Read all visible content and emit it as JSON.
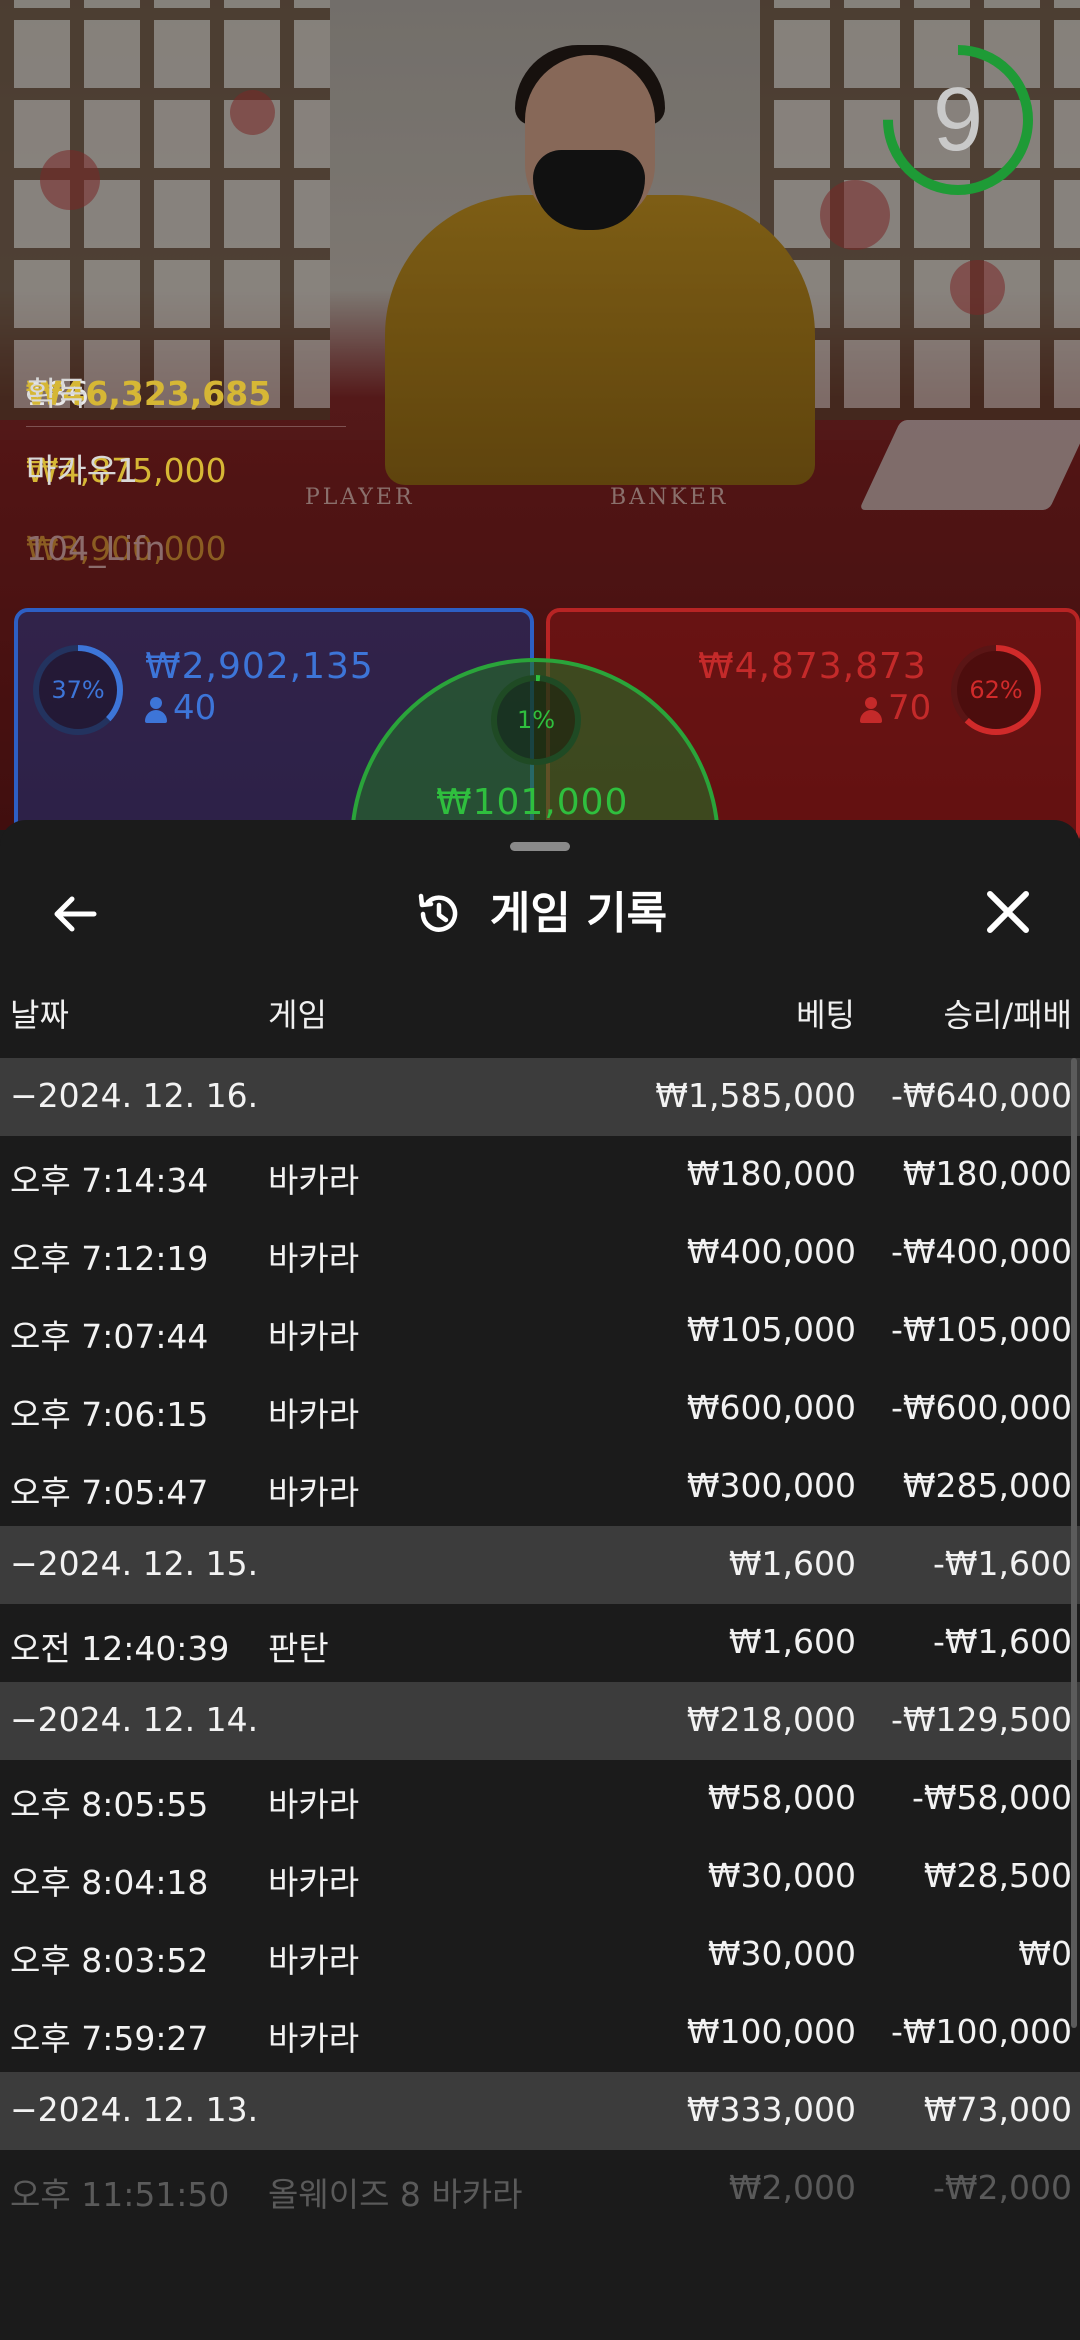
{
  "live": {
    "timer": "9",
    "winners": {
      "count": "186",
      "total": "₩46,323,685",
      "gain_label": "획득",
      "rows": [
        {
          "amount": "₩4,875,000",
          "name": "마카우1"
        },
        {
          "amount": "₩3,900,000",
          "name": "104_Lifn"
        }
      ]
    },
    "table_labels": {
      "player": "PLAYER",
      "banker": "BANKER"
    },
    "player": {
      "percent": "37%",
      "amount": "₩2,902,135",
      "players": "40",
      "color": "#3d75d8"
    },
    "banker": {
      "percent": "62%",
      "amount": "₩4,873,873",
      "players": "70",
      "color": "#c42a2a"
    },
    "tie": {
      "percent": "1%",
      "amount": "₩101,000",
      "color": "#2fbf3e"
    }
  },
  "history": {
    "title": "게임 기록",
    "icons": {
      "back": "arrow-left-icon",
      "history": "history-icon",
      "close": "close-icon"
    },
    "columns": {
      "date": "날짜",
      "game": "게임",
      "bet": "베팅",
      "result": "승리/패배"
    },
    "rows": [
      {
        "type": "group",
        "date": "−2024. 12. 16.",
        "game": "",
        "bet": "₩1,585,000",
        "result": "-₩640,000"
      },
      {
        "type": "item",
        "date": "오후 7:14:34",
        "game": "바카라",
        "bet": "₩180,000",
        "result": "₩180,000"
      },
      {
        "type": "item",
        "date": "오후 7:12:19",
        "game": "바카라",
        "bet": "₩400,000",
        "result": "-₩400,000"
      },
      {
        "type": "item",
        "date": "오후 7:07:44",
        "game": "바카라",
        "bet": "₩105,000",
        "result": "-₩105,000"
      },
      {
        "type": "item",
        "date": "오후 7:06:15",
        "game": "바카라",
        "bet": "₩600,000",
        "result": "-₩600,000"
      },
      {
        "type": "item",
        "date": "오후 7:05:47",
        "game": "바카라",
        "bet": "₩300,000",
        "result": "₩285,000"
      },
      {
        "type": "group",
        "date": "−2024. 12. 15.",
        "game": "",
        "bet": "₩1,600",
        "result": "-₩1,600"
      },
      {
        "type": "item",
        "date": "오전 12:40:39",
        "game": "판탄",
        "bet": "₩1,600",
        "result": "-₩1,600"
      },
      {
        "type": "group",
        "date": "−2024. 12. 14.",
        "game": "",
        "bet": "₩218,000",
        "result": "-₩129,500"
      },
      {
        "type": "item",
        "date": "오후 8:05:55",
        "game": "바카라",
        "bet": "₩58,000",
        "result": "-₩58,000"
      },
      {
        "type": "item",
        "date": "오후 8:04:18",
        "game": "바카라",
        "bet": "₩30,000",
        "result": "₩28,500"
      },
      {
        "type": "item",
        "date": "오후 8:03:52",
        "game": "바카라",
        "bet": "₩30,000",
        "result": "₩0"
      },
      {
        "type": "item",
        "date": "오후 7:59:27",
        "game": "바카라",
        "bet": "₩100,000",
        "result": "-₩100,000"
      },
      {
        "type": "group",
        "date": "−2024. 12. 13.",
        "game": "",
        "bet": "₩333,000",
        "result": "₩73,000"
      },
      {
        "type": "item faded",
        "date": "오후 11:51:50",
        "game": "올웨이즈 8 바카라",
        "bet": "₩2,000",
        "result": "-₩2,000"
      }
    ]
  }
}
